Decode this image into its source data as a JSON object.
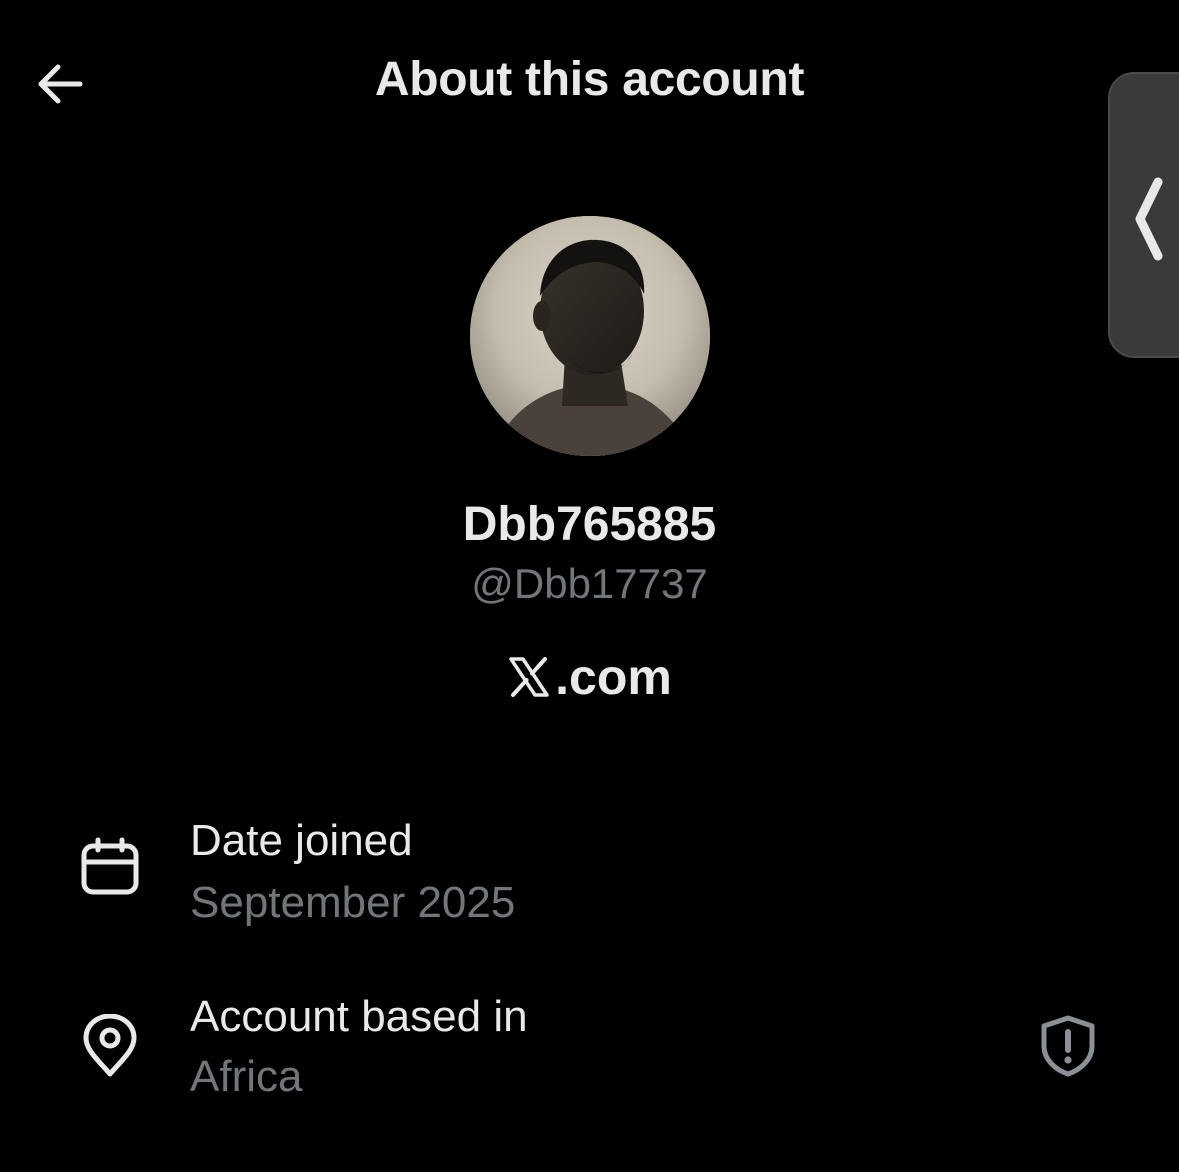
{
  "header": {
    "title": "About this account",
    "back_icon": "arrow-left-icon"
  },
  "side_handle": {
    "icon": "chevron-left-icon"
  },
  "profile": {
    "display_name": "Dbb765885",
    "handle": "@Dbb17737",
    "site_label": ".com",
    "site_icon": "x-logo-icon"
  },
  "info": {
    "date_joined": {
      "label": "Date joined",
      "value": "September 2025",
      "icon": "calendar-icon"
    },
    "account_based_in": {
      "label": "Account based in",
      "value": "Africa",
      "icon": "location-pin-icon",
      "trailing_icon": "shield-alert-icon"
    }
  },
  "colors": {
    "background": "#000000",
    "primary_text": "#e7e9ea",
    "secondary_text": "#71767b",
    "handle_bg": "#3a3a3c"
  }
}
